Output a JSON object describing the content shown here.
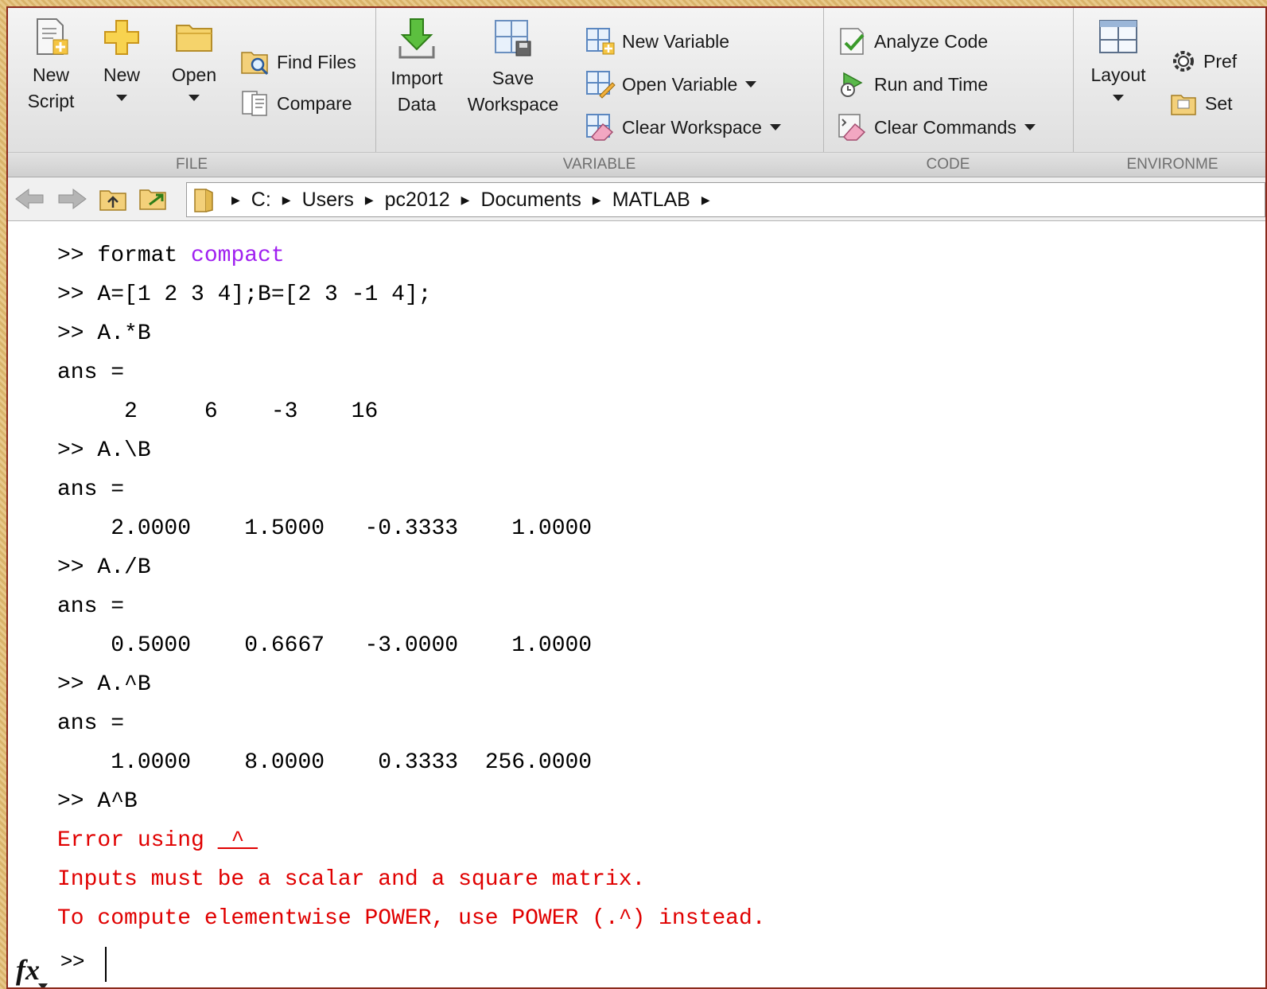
{
  "toolstrip": {
    "file": {
      "label": "FILE",
      "new_script": [
        "New",
        "Script"
      ],
      "new": "New",
      "open": "Open",
      "find_files": "Find Files",
      "compare": "Compare"
    },
    "variable": {
      "label": "VARIABLE",
      "import": [
        "Import",
        "Data"
      ],
      "save": [
        "Save",
        "Workspace"
      ],
      "new_variable": "New Variable",
      "open_variable": "Open Variable",
      "clear_workspace": "Clear Workspace"
    },
    "code": {
      "label": "CODE",
      "analyze_code": "Analyze Code",
      "run_and_time": "Run and Time",
      "clear_commands": "Clear Commands"
    },
    "environment": {
      "label": "ENVIRONME",
      "layout": "Layout",
      "preferences": "Pref",
      "set_path": "Set"
    }
  },
  "address": {
    "crumbs": [
      "C:",
      "Users",
      "pc2012",
      "Documents",
      "MATLAB"
    ]
  },
  "command_window": {
    "lines": [
      ">> format ",
      ">> A=[1 2 3 4];B=[2 3 -1 4];",
      ">> A.*B",
      "ans =",
      "     2     6    -3    16",
      ">> A.\\B",
      "ans =",
      "    2.0000    1.5000   -0.3333    1.0000",
      ">> A./B",
      "ans =",
      "    0.5000    0.6667   -3.0000    1.0000",
      ">> A.^B",
      "ans =",
      "    1.0000    8.0000    0.3333  256.0000",
      ">> A^B"
    ],
    "format_arg": "compact",
    "errors": [
      "Error using ",
      "Inputs must be a scalar and a square matrix.",
      "To compute elementwise POWER, use POWER (.^) instead."
    ],
    "error_link": " ^ ",
    "fx_label": "fx",
    "prompt": ">>"
  }
}
